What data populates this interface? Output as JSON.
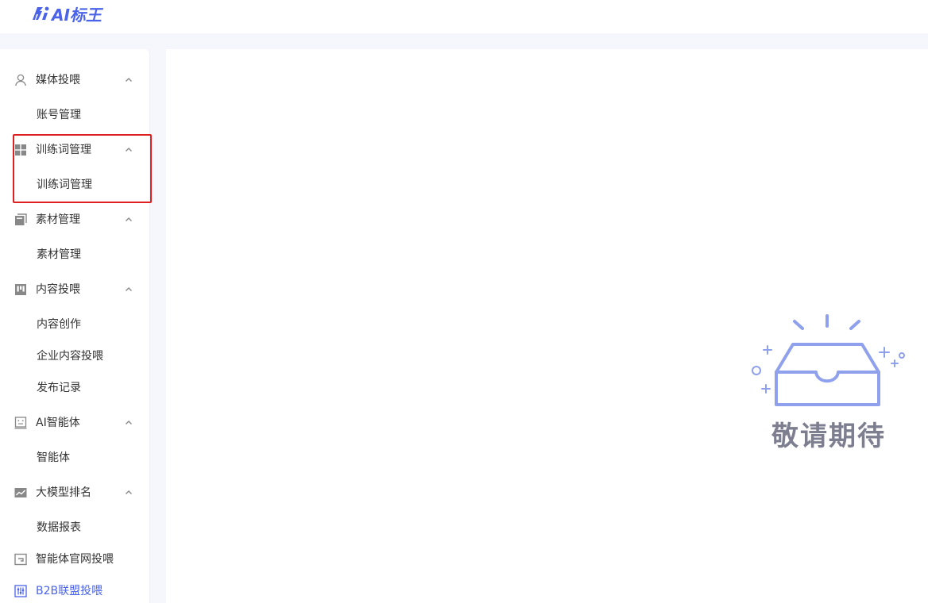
{
  "app": {
    "logo_text": "AI标王"
  },
  "sidebar": {
    "groups": [
      {
        "label": "媒体投喂",
        "icon": "user-icon",
        "items": [
          "账号管理"
        ]
      },
      {
        "label": "训练词管理",
        "icon": "grid-icon",
        "items": [
          "训练词管理"
        ]
      },
      {
        "label": "素材管理",
        "icon": "folder-icon",
        "items": [
          "素材管理"
        ]
      },
      {
        "label": "内容投喂",
        "icon": "board-icon",
        "items": [
          "内容创作",
          "企业内容投喂",
          "发布记录"
        ]
      },
      {
        "label": "AI智能体",
        "icon": "robot-icon",
        "items": [
          "智能体"
        ]
      },
      {
        "label": "大模型排名",
        "icon": "chart-icon",
        "items": [
          "数据报表"
        ]
      },
      {
        "label": "智能体官网投喂",
        "icon": "window-icon",
        "items": []
      },
      {
        "label": "B2B联盟投喂",
        "icon": "sliders-icon",
        "items": []
      }
    ]
  },
  "main": {
    "empty_state_text": "敬请期待"
  },
  "colors": {
    "accent": "#4a63e8",
    "highlight_border": "#e02020",
    "illustration": "#8fa0ec",
    "empty_text": "#7d7f90"
  }
}
